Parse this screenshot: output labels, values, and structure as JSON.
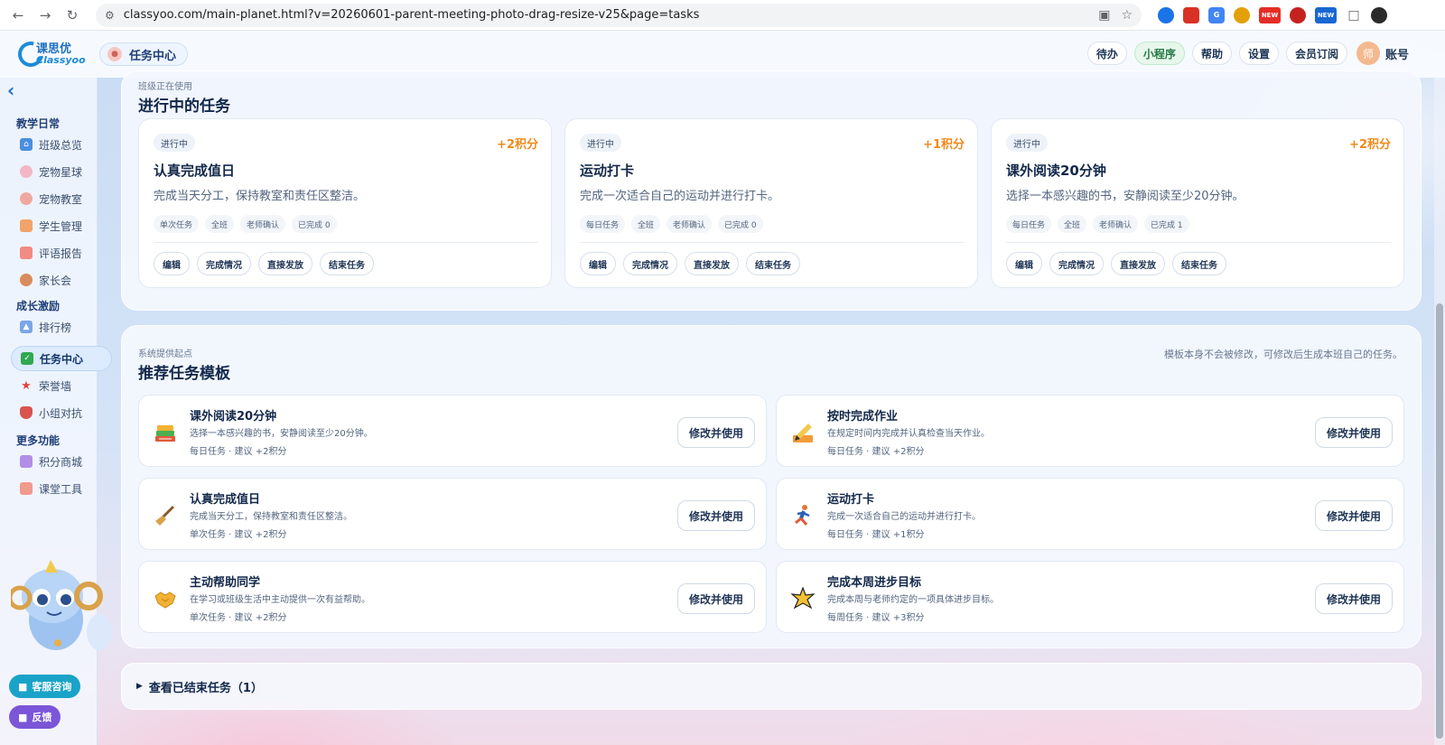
{
  "browser": {
    "url": "classyoo.com/main-planet.html?v=20260601-parent-meeting-photo-drag-resize-v25&page=tasks",
    "ext_badge_1": "NEW",
    "ext_badge_2": "NEW"
  },
  "header": {
    "logo_cn": "课思优",
    "logo_en": "Classyoo",
    "module_label": "任务中心",
    "actions": {
      "todo": "待办",
      "miniapp": "小程序",
      "help": "帮助",
      "settings": "设置",
      "membership": "会员订阅"
    },
    "avatar_char": "师",
    "account_label": "账号"
  },
  "sidebar": {
    "groups": {
      "daily": "教学日常",
      "growth": "成长激励",
      "more": "更多功能"
    },
    "items": {
      "class_overview": "班级总览",
      "pet_planet": "宠物星球",
      "pet_classroom": "宠物教室",
      "student_mgmt": "学生管理",
      "comment_report": "评语报告",
      "parent_meeting": "家长会",
      "leaderboard": "排行榜",
      "task_center": "任务中心",
      "honor_wall": "荣誉墙",
      "team_battle": "小组对抗",
      "points_mall": "积分商城",
      "class_tools": "课堂工具"
    },
    "support_btn": "客服咨询",
    "feedback_btn": "反馈"
  },
  "active_tasks": {
    "eyebrow": "班级正在使用",
    "title": "进行中的任务",
    "cards": [
      {
        "status": "进行中",
        "points": "+2积分",
        "title": "认真完成值日",
        "desc": "完成当天分工，保持教室和责任区整洁。",
        "tags": [
          "单次任务",
          "全班",
          "老师确认",
          "已完成 0"
        ],
        "actions": [
          "编辑",
          "完成情况",
          "直接发放",
          "结束任务"
        ]
      },
      {
        "status": "进行中",
        "points": "+1积分",
        "title": "运动打卡",
        "desc": "完成一次适合自己的运动并进行打卡。",
        "tags": [
          "每日任务",
          "全班",
          "老师确认",
          "已完成 0"
        ],
        "actions": [
          "编辑",
          "完成情况",
          "直接发放",
          "结束任务"
        ]
      },
      {
        "status": "进行中",
        "points": "+2积分",
        "title": "课外阅读20分钟",
        "desc": "选择一本感兴趣的书，安静阅读至少20分钟。",
        "tags": [
          "每日任务",
          "全班",
          "老师确认",
          "已完成 1"
        ],
        "actions": [
          "编辑",
          "完成情况",
          "直接发放",
          "结束任务"
        ]
      }
    ]
  },
  "templates": {
    "eyebrow": "系统提供起点",
    "title": "推荐任务模板",
    "note": "模板本身不会被修改，可修改后生成本班自己的任务。",
    "button_label": "修改并使用",
    "items": [
      {
        "icon": "books-icon",
        "title": "课外阅读20分钟",
        "desc": "选择一本感兴趣的书，安静阅读至少20分钟。",
        "meta": "每日任务 · 建议 +2积分"
      },
      {
        "icon": "pencil-icon",
        "title": "按时完成作业",
        "desc": "在规定时间内完成并认真检查当天作业。",
        "meta": "每日任务 · 建议 +2积分"
      },
      {
        "icon": "broom-icon",
        "title": "认真完成值日",
        "desc": "完成当天分工，保持教室和责任区整洁。",
        "meta": "单次任务 · 建议 +2积分"
      },
      {
        "icon": "runner-icon",
        "title": "运动打卡",
        "desc": "完成一次适合自己的运动并进行打卡。",
        "meta": "每日任务 · 建议 +1积分"
      },
      {
        "icon": "handshake-icon",
        "title": "主动帮助同学",
        "desc": "在学习或班级生活中主动提供一次有益帮助。",
        "meta": "单次任务 · 建议 +2积分"
      },
      {
        "icon": "star-burst-icon",
        "title": "完成本周进步目标",
        "desc": "完成本周与老师约定的一项具体进步目标。",
        "meta": "每周任务 · 建议 +3积分"
      }
    ]
  },
  "ended": {
    "label": "查看已结束任务（1）"
  },
  "colors": {
    "accent": "#1e6fc0",
    "points": "#ef8a1b",
    "support": "#1aa3c8",
    "feedback": "#7b56d8"
  }
}
